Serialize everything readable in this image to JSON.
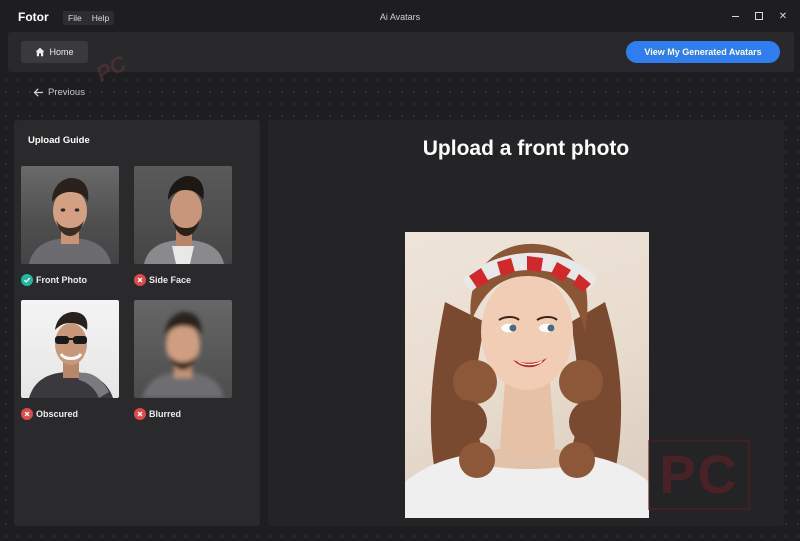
{
  "app": {
    "brand": "Fotor",
    "menu": [
      "File",
      "Help"
    ],
    "window_title": "Ai Avatars"
  },
  "header": {
    "home_label": "Home",
    "generated_label": "View My Generated Avatars"
  },
  "nav": {
    "previous_label": "Previous"
  },
  "guide": {
    "title": "Upload Guide",
    "items": [
      {
        "label": "Front Photo",
        "status": "ok"
      },
      {
        "label": "Side Face",
        "status": "bad"
      },
      {
        "label": "Obscured",
        "status": "bad"
      },
      {
        "label": "Blurred",
        "status": "bad"
      }
    ]
  },
  "main": {
    "title": "Upload a front photo"
  },
  "colors": {
    "accent": "#2f7ef0",
    "ok": "#22b7a2",
    "bad": "#e0484c",
    "background": "#1e1e20"
  }
}
